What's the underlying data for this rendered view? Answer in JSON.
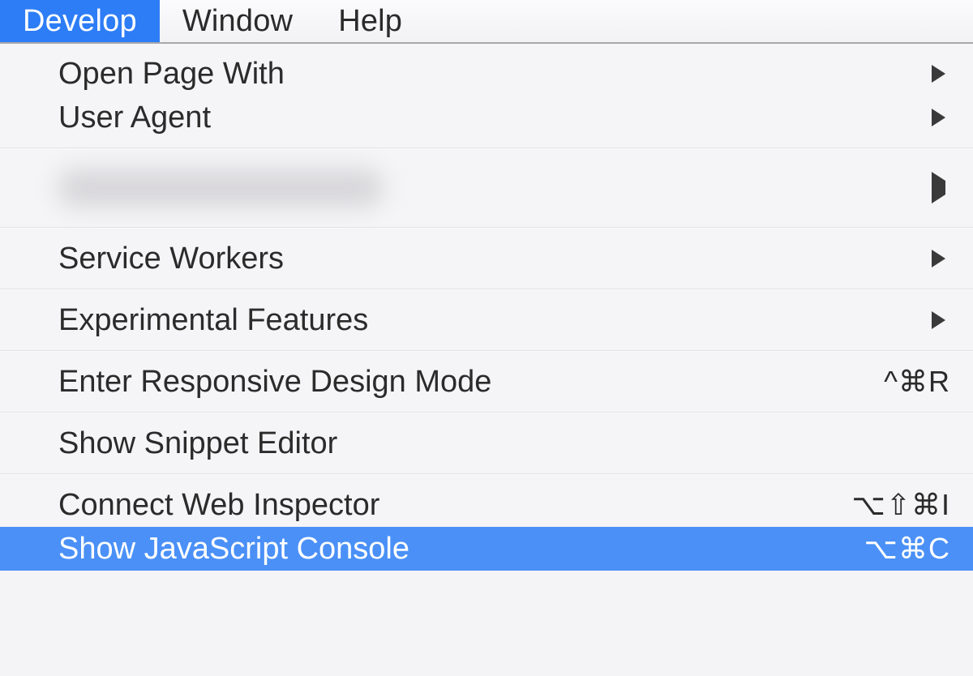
{
  "menubar": {
    "items": [
      {
        "label": "Develop",
        "selected": true
      },
      {
        "label": "Window",
        "selected": false
      },
      {
        "label": "Help",
        "selected": false
      }
    ]
  },
  "menu": {
    "open_page_with": {
      "label": "Open Page With",
      "has_submenu": true
    },
    "user_agent": {
      "label": "User Agent",
      "has_submenu": true
    },
    "redacted_device": {
      "label": "",
      "has_submenu": true,
      "redacted": true
    },
    "service_workers": {
      "label": "Service Workers",
      "has_submenu": true
    },
    "experimental": {
      "label": "Experimental Features",
      "has_submenu": true
    },
    "responsive": {
      "label": "Enter Responsive Design Mode",
      "shortcut": "^⌘R"
    },
    "snippet_editor": {
      "label": "Show Snippet Editor"
    },
    "connect_inspector": {
      "label": "Connect Web Inspector",
      "shortcut": "⌥⇧⌘I"
    },
    "js_console": {
      "label": "Show JavaScript Console",
      "shortcut": "⌥⌘C",
      "highlighted": true
    }
  }
}
